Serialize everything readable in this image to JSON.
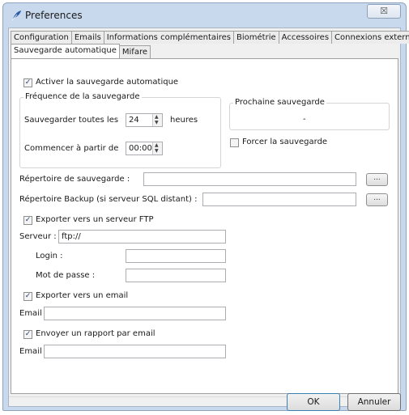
{
  "window": {
    "title": "Preferences",
    "close_symbol": "☒"
  },
  "tabs_row1": [
    {
      "label": "Configuration"
    },
    {
      "label": "Emails"
    },
    {
      "label": "Informations complémentaires"
    },
    {
      "label": "Biométrie"
    },
    {
      "label": "Accessoires"
    },
    {
      "label": "Connexions externes"
    }
  ],
  "tabs_row2": [
    {
      "label": "Sauvegarde automatique",
      "active": true
    },
    {
      "label": "Mifare",
      "active": false
    }
  ],
  "auto_backup": {
    "enable_label": "Activer la sauvegarde automatique",
    "enable_checked": true
  },
  "frequency": {
    "group_title": "Fréquence de la sauvegarde",
    "every_label": "Sauvegarder toutes les",
    "every_value": "24",
    "every_unit": "heures",
    "start_label": "Commencer à partir de",
    "start_value": "00:00"
  },
  "next_backup": {
    "group_title": "Prochaine sauvegarde",
    "value": "-"
  },
  "force_backup": {
    "label": "Forcer la sauvegarde",
    "checked": false
  },
  "backup_dir": {
    "label": "Répertoire de sauvegarde :",
    "value": "",
    "browse_label": "..."
  },
  "backup_sql_dir": {
    "label": "Répertoire Backup (si serveur SQL distant) :",
    "value": "",
    "browse_label": "..."
  },
  "ftp": {
    "export_label": "Exporter vers un serveur FTP",
    "export_checked": true,
    "server_label": "Serveur :",
    "server_value": "ftp://",
    "login_label": "Login :",
    "login_value": "",
    "password_label": "Mot de passe :",
    "password_value": ""
  },
  "email_export": {
    "label": "Exporter vers un email",
    "checked": true,
    "email_label": "Email :",
    "email_value": ""
  },
  "email_report": {
    "label": "Envoyer un rapport par email",
    "checked": true,
    "email_label": "Email :",
    "email_value": ""
  },
  "buttons": {
    "ok": "OK",
    "cancel": "Annuler"
  },
  "check_glyph": "✓"
}
